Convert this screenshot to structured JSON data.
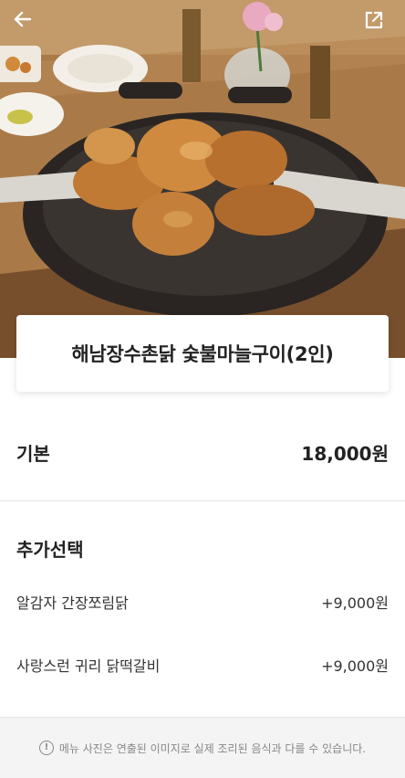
{
  "header": {
    "back_icon": "arrow-left-icon",
    "share_icon": "share-external-icon"
  },
  "product": {
    "title": "해남장수촌닭 숯불마늘구이(2인)"
  },
  "base": {
    "label": "기본",
    "price": "18,000원"
  },
  "options": {
    "section_title": "추가선택",
    "items": [
      {
        "name": "알감자 간장쪼림닭",
        "price": "+9,000원"
      },
      {
        "name": "사랑스런 귀리 닭떡갈비",
        "price": "+9,000원"
      }
    ]
  },
  "notice": {
    "icon": "info-exclamation-icon",
    "text": "메뉴 사진은 연출된 이미지로 실제 조리된 음식과 다를 수 있습니다."
  },
  "colors": {
    "text": "#222222",
    "divider": "#e6e6e6",
    "notice_bg": "#f4f4f4",
    "notice_text": "#888888"
  }
}
